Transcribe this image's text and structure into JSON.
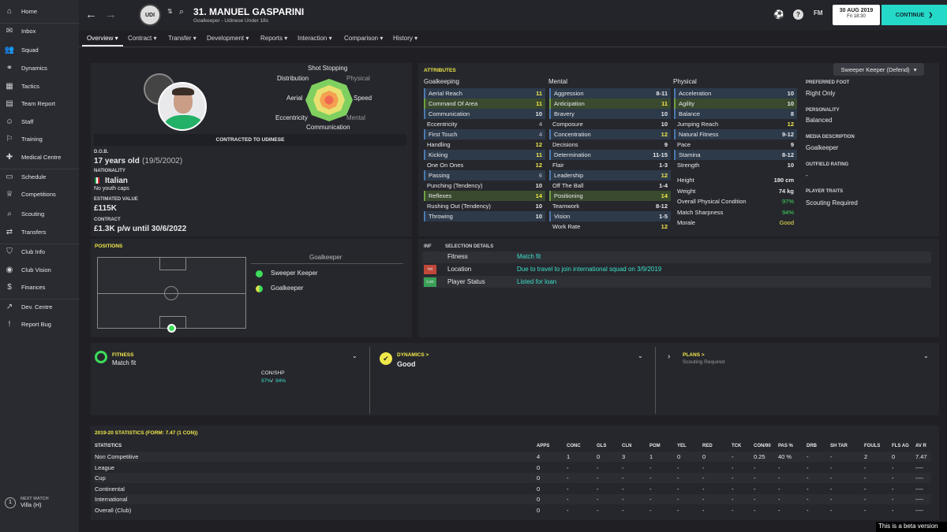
{
  "sidebar": {
    "items": [
      {
        "label": "Home",
        "icon": "home-icon"
      },
      {
        "label": "Inbox",
        "icon": "inbox-icon"
      },
      {
        "label": "Squad",
        "icon": "squad-icon"
      },
      {
        "label": "Dynamics",
        "icon": "dynamics-icon"
      },
      {
        "label": "Tactics",
        "icon": "tactics-icon"
      },
      {
        "label": "Team Report",
        "icon": "report-icon"
      },
      {
        "label": "Staff",
        "icon": "staff-icon"
      },
      {
        "label": "Training",
        "icon": "training-icon"
      },
      {
        "label": "Medical Centre",
        "icon": "medical-icon"
      },
      {
        "label": "Schedule",
        "icon": "schedule-icon"
      },
      {
        "label": "Competitions",
        "icon": "trophy-icon"
      },
      {
        "label": "Scouting",
        "icon": "scouting-icon"
      },
      {
        "label": "Transfers",
        "icon": "transfers-icon"
      },
      {
        "label": "Club Info",
        "icon": "club-info-icon"
      },
      {
        "label": "Club Vision",
        "icon": "vision-icon"
      },
      {
        "label": "Finances",
        "icon": "finances-icon"
      },
      {
        "label": "Dev. Centre",
        "icon": "dev-icon"
      },
      {
        "label": "Report Bug",
        "icon": "bug-icon"
      }
    ],
    "next_match_label": "NEXT MATCH",
    "next_match": "Villa (H)",
    "next_match_num": "1"
  },
  "header": {
    "title": "31. MANUEL GASPARINI",
    "subtitle": "Goalkeeper - Udinese Under 18s",
    "date": "30 AUG 2019",
    "day": "Fri 18:30",
    "continue": "CONTINUE",
    "fm": "FM"
  },
  "tabs": [
    "Overview",
    "Contract",
    "Transfer",
    "Development",
    "Reports",
    "Interaction",
    "Comparison",
    "History"
  ],
  "profile": {
    "hex_labels": {
      "top": "Shot Stopping",
      "tl": "Distribution",
      "tr": "Physical",
      "l": "Aerial",
      "r": "Speed",
      "bl": "Eccentricity",
      "br": "Mental",
      "b": "Communication"
    },
    "contracted": "CONTRACTED TO UDINESE",
    "dob_label": "D.O.B.",
    "dob_age": "17 years old",
    "dob_date": "(19/5/2002)",
    "nat_label": "NATIONALITY",
    "nat": "Italian",
    "caps": "No youth caps",
    "value_label": "ESTIMATED VALUE",
    "value": "£115K",
    "contract_label": "CONTRACT",
    "contract": "£1.3K p/w until 30/6/2022"
  },
  "attributes": {
    "title": "ATTRIBUTES",
    "role": "Sweeper Keeper (Defend)",
    "gk_title": "Goalkeeping",
    "mental_title": "Mental",
    "physical_title": "Physical",
    "goalkeeping": [
      [
        "Aerial Reach",
        "11"
      ],
      [
        "Command Of Area",
        "11"
      ],
      [
        "Communication",
        "10"
      ],
      [
        "Eccentricity",
        "4"
      ],
      [
        "First Touch",
        "4"
      ],
      [
        "Handling",
        "12"
      ],
      [
        "Kicking",
        "11"
      ],
      [
        "One On Ones",
        "12"
      ],
      [
        "Passing",
        "6"
      ],
      [
        "Punching (Tendency)",
        "10"
      ],
      [
        "Reflexes",
        "14"
      ],
      [
        "Rushing Out (Tendency)",
        "10"
      ],
      [
        "Throwing",
        "10"
      ]
    ],
    "mental": [
      [
        "Aggression",
        "8-11"
      ],
      [
        "Anticipation",
        "11"
      ],
      [
        "Bravery",
        "10"
      ],
      [
        "Composure",
        "10"
      ],
      [
        "Concentration",
        "12"
      ],
      [
        "Decisions",
        "9"
      ],
      [
        "Determination",
        "11-15"
      ],
      [
        "Flair",
        "1-3"
      ],
      [
        "Leadership",
        "12"
      ],
      [
        "Off The Ball",
        "1-4"
      ],
      [
        "Positioning",
        "14"
      ],
      [
        "Teamwork",
        "8-12"
      ],
      [
        "Vision",
        "1-5"
      ],
      [
        "Work Rate",
        "12"
      ]
    ],
    "physical": [
      [
        "Acceleration",
        "10"
      ],
      [
        "Agility",
        "10"
      ],
      [
        "Balance",
        "8"
      ],
      [
        "Jumping Reach",
        "12"
      ],
      [
        "Natural Fitness",
        "9-12"
      ],
      [
        "Pace",
        "9"
      ],
      [
        "Stamina",
        "8-12"
      ],
      [
        "Strength",
        "10"
      ]
    ],
    "extra": [
      [
        "Height",
        "190 cm"
      ],
      [
        "Weight",
        "74 kg"
      ],
      [
        "Overall Physical Condition",
        "97%"
      ],
      [
        "Match Sharpness",
        "94%"
      ],
      [
        "Morale",
        "Good"
      ]
    ]
  },
  "info": {
    "foot_label": "PREFERRED FOOT",
    "foot": "Right Only",
    "pers_label": "PERSONALITY",
    "pers": "Balanced",
    "media_label": "MEDIA DESCRIPTION",
    "media": "Goalkeeper",
    "outfield_label": "OUTFIELD RATING",
    "outfield": "-",
    "traits_label": "PLAYER TRAITS",
    "traits": "Scouting Required"
  },
  "positions": {
    "title": "POSITIONS",
    "main": "Goalkeeper",
    "list": [
      "Sweeper Keeper",
      "Goalkeeper"
    ]
  },
  "selection": {
    "col1": "INF",
    "col2": "SELECTION DETAILS",
    "rows": [
      {
        "badge": "",
        "label": "Fitness",
        "value": "Match fit"
      },
      {
        "badge": "Int",
        "label": "Location",
        "value": "Due to travel to join international squad on 3/9/2019"
      },
      {
        "badge": "Lon",
        "label": "Player Status",
        "value": "Listed for loan"
      }
    ]
  },
  "cards": {
    "fitness_label": "FITNESS",
    "fitness": "Match fit",
    "con_label": "CON/SHP",
    "con_val": "97%",
    "shp_val": "94%",
    "dyn_label": "DYNAMICS >",
    "dyn": "Good",
    "plans_label": "PLANS >",
    "plans": "Scouting Required"
  },
  "stats": {
    "title": "2019-20 STATISTICS (FORM: 7.47 (1 CON))",
    "headers": [
      "STATISTICS",
      "APPS",
      "CONC",
      "GLS",
      "CLN",
      "POM",
      "YEL",
      "RED",
      "TCK",
      "CON/90",
      "PAS %",
      "DRB",
      "SH TAR",
      "FOULS",
      "FLS AG",
      "AV R"
    ],
    "rows": [
      [
        "Non Competitive",
        "4",
        "1",
        "0",
        "3",
        "1",
        "0",
        "0",
        "-",
        "0.25",
        "40 %",
        "-",
        "-",
        "2",
        "0",
        "7.47"
      ],
      [
        "League",
        "0",
        "-",
        "-",
        "-",
        "-",
        "-",
        "-",
        "-",
        "-",
        "-",
        "-",
        "-",
        "-",
        "-",
        "----"
      ],
      [
        "Cup",
        "0",
        "-",
        "-",
        "-",
        "-",
        "-",
        "-",
        "-",
        "-",
        "-",
        "-",
        "-",
        "-",
        "-",
        "----"
      ],
      [
        "Continental",
        "0",
        "-",
        "-",
        "-",
        "-",
        "-",
        "-",
        "-",
        "-",
        "-",
        "-",
        "-",
        "-",
        "-",
        "----"
      ],
      [
        "International",
        "0",
        "-",
        "-",
        "-",
        "-",
        "-",
        "-",
        "-",
        "-",
        "-",
        "-",
        "-",
        "-",
        "-",
        "----"
      ],
      [
        "Overall (Club)",
        "0",
        "-",
        "-",
        "-",
        "-",
        "-",
        "-",
        "-",
        "-",
        "-",
        "-",
        "-",
        "-",
        "-",
        "----"
      ]
    ]
  },
  "beta": "This is a beta version",
  "colors": {
    "accent": "#25d9c9",
    "yellow": "#f0e84a",
    "green": "#3ddc5a"
  }
}
